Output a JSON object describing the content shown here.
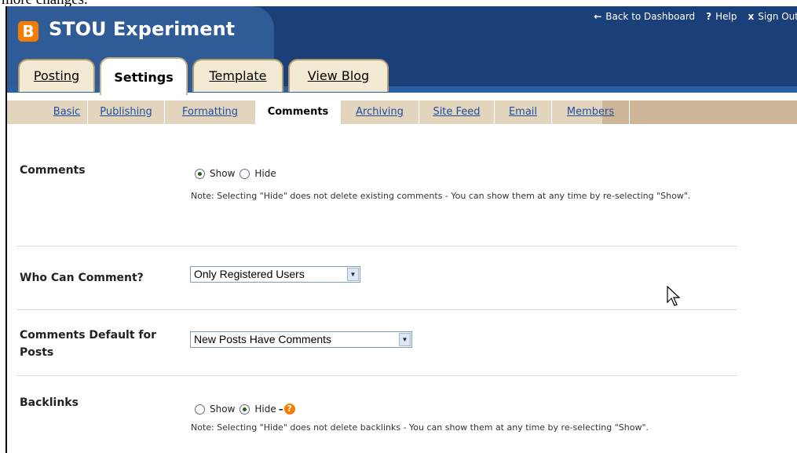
{
  "top_fragment": "more changes.",
  "header": {
    "logo_letter": "B",
    "blog_title": "STOU Experiment",
    "nav": {
      "back_glyph": "←",
      "back_label": "Back to Dashboard",
      "help_glyph": "?",
      "help_label": "Help",
      "signout_glyph": "x",
      "signout_label": "Sign Out"
    }
  },
  "main_tabs": [
    "Posting",
    "Settings",
    "Template",
    "View Blog"
  ],
  "sub_tabs": [
    "Basic",
    "Publishing",
    "Formatting",
    "Comments",
    "Archiving",
    "Site Feed",
    "Email",
    "Members"
  ],
  "sections": {
    "comments": {
      "label": "Comments",
      "opt_show": "Show",
      "opt_hide": "Hide",
      "selected": "Show",
      "note": "Note: Selecting \"Hide\" does not delete existing comments - You can show them at any time by re-selecting \"Show\"."
    },
    "who_can_comment": {
      "label": "Who Can Comment?",
      "selected": "Only Registered Users"
    },
    "default_for_posts": {
      "label": "Comments Default for Posts",
      "selected": "New Posts Have Comments"
    },
    "backlinks": {
      "label": "Backlinks",
      "opt_show": "Show",
      "opt_hide": "Hide",
      "dash": "–",
      "help_glyph": "?",
      "selected": "Hide",
      "note": "Note: Selecting \"Hide\" does not delete backlinks - You can show them at any time by re-selecting \"Show\"."
    }
  },
  "colors": {
    "header_bg": "#1b3f79",
    "logo_orange": "#f57d00",
    "tab_bg": "#f3ead3",
    "subtab_bar": "#e2d4bd",
    "link_blue": "#1d4e9d"
  }
}
